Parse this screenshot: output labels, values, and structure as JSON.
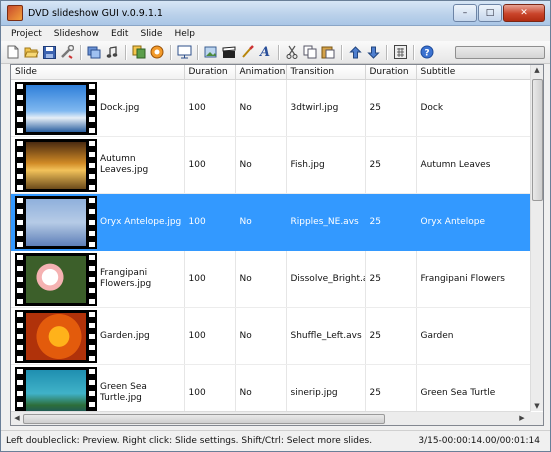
{
  "window": {
    "title": "DVD slideshow GUI v.0.9.1.1"
  },
  "menu": [
    "Project",
    "Slideshow",
    "Edit",
    "Slide",
    "Help"
  ],
  "toolbar": {
    "icons": [
      "new-project-icon",
      "open-project-icon",
      "save-project-icon",
      "settings-tools-icon",
      "add-slides-icon",
      "add-audio-icon",
      "copy-slides-icon",
      "record-icon",
      "preview-icon",
      "edit-image-icon",
      "clapperboard-icon",
      "paint-brush-icon",
      "text-icon",
      "cut-icon",
      "copy-icon",
      "paste-icon",
      "move-up-icon",
      "move-down-icon",
      "calculator-icon",
      "help-icon"
    ],
    "progress": 0
  },
  "table": {
    "columns": [
      "Slide",
      "Duration",
      "Animation",
      "Transition",
      "Duration",
      "Subtitle"
    ],
    "rows": [
      {
        "file": "Dock.jpg",
        "duration": "100",
        "animation": "No",
        "transition": "3dtwirl.jpg",
        "trans_duration": "25",
        "subtitle": "Dock",
        "selected": false
      },
      {
        "file": "Autumn Leaves.jpg",
        "duration": "100",
        "animation": "No",
        "transition": "Fish.jpg",
        "trans_duration": "25",
        "subtitle": "Autumn Leaves",
        "selected": false
      },
      {
        "file": "Oryx Antelope.jpg",
        "duration": "100",
        "animation": "No",
        "transition": "Ripples_NE.avs",
        "trans_duration": "25",
        "subtitle": "Oryx Antelope",
        "selected": true
      },
      {
        "file": "Frangipani Flowers.jpg",
        "duration": "100",
        "animation": "No",
        "transition": "Dissolve_Bright.a...",
        "trans_duration": "25",
        "subtitle": "Frangipani Flowers",
        "selected": false
      },
      {
        "file": "Garden.jpg",
        "duration": "100",
        "animation": "No",
        "transition": "Shuffle_Left.avs",
        "trans_duration": "25",
        "subtitle": "Garden",
        "selected": false
      },
      {
        "file": "Green Sea Turtle.jpg",
        "duration": "100",
        "animation": "No",
        "transition": "sinerip.jpg",
        "trans_duration": "25",
        "subtitle": "Green Sea Turtle",
        "selected": false
      }
    ]
  },
  "status": {
    "hint": "Left doubleclick: Preview. Right click: Slide settings. Shift/Ctrl: Select more slides.",
    "position": "3/15-00:00:14.00/00:01:14"
  },
  "colors": {
    "selection": "#3399ff",
    "titlebar": "#b9d0ea"
  }
}
